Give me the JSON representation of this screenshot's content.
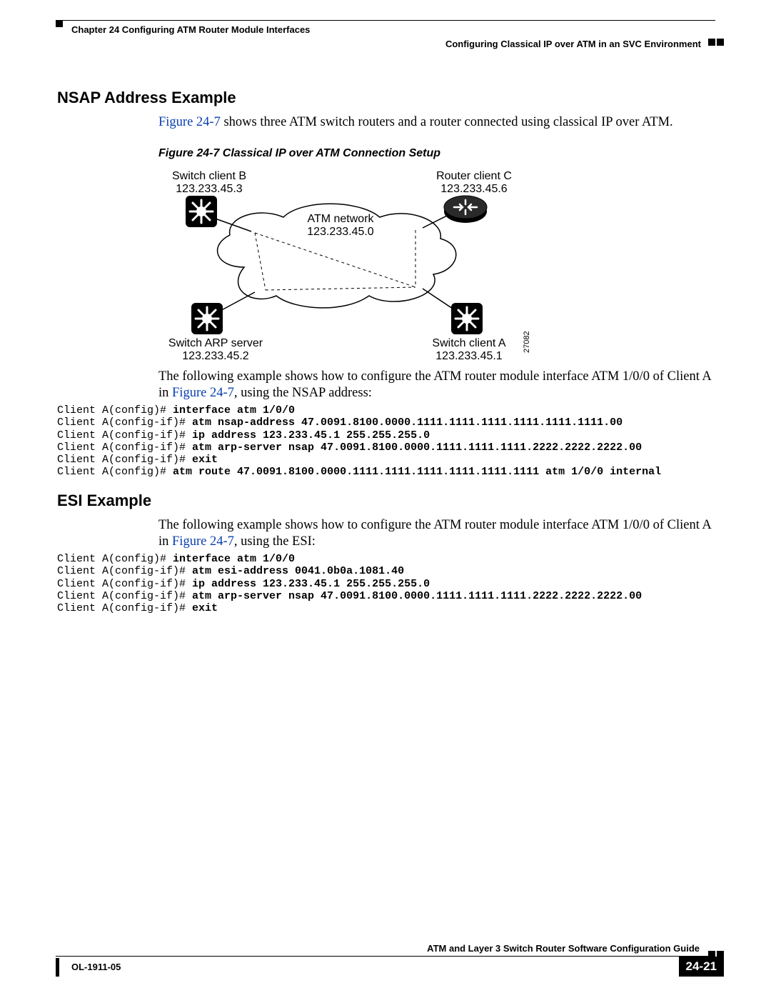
{
  "header": {
    "chapter": "Chapter 24    Configuring ATM Router Module Interfaces",
    "section": "Configuring Classical IP over ATM in an SVC Environment"
  },
  "h1_nsap": "NSAP Address Example",
  "p1_a": "Figure 24-7",
  "p1_b": " shows three ATM switch routers and a router connected using classical IP over ATM.",
  "fig_caption": "Figure 24-7   Classical IP over ATM Connection Setup",
  "diagram": {
    "switch_b_name": "Switch client B",
    "switch_b_ip": "123.233.45.3",
    "router_c_name": "Router client C",
    "router_c_ip": "123.233.45.6",
    "net_name": "ATM network",
    "net_ip": "123.233.45.0",
    "arp_name": "Switch ARP server",
    "arp_ip": "123.233.45.2",
    "switch_a_name": "Switch client A",
    "switch_a_ip": "123.233.45.1",
    "fig_id": "27082"
  },
  "p2_a": "The following example shows how to configure the ATM router module interface ATM 1/0/0 of Client A in ",
  "p2_link": "Figure 24-7",
  "p2_b": ", using the NSAP address:",
  "cli1": {
    "l1p": "Client A(config)# ",
    "l1b": "interface atm 1/0/0",
    "l2p": "Client A(config-if)# ",
    "l2b": "atm nsap-address 47.0091.8100.0000.1111.1111.1111.1111.1111.1111.00",
    "l3p": "Client A(config-if)# ",
    "l3b": "ip address 123.233.45.1 255.255.255.0",
    "l4p": "Client A(config-if)# ",
    "l4b": "atm arp-server nsap 47.0091.8100.0000.1111.1111.1111.2222.2222.2222.00",
    "l5p": "Client A(config-if)# ",
    "l5b": "exit",
    "l6p": "Client A(config)# ",
    "l6b": "atm route 47.0091.8100.0000.1111.1111.1111.1111.1111.1111 atm 1/0/0 internal"
  },
  "h1_esi": "ESI Example",
  "p3_a": "The following example shows how to configure the ATM router module interface ATM 1/0/0 of Client A in ",
  "p3_link": "Figure 24-7",
  "p3_b": ", using the ESI:",
  "cli2": {
    "l1p": "Client A(config)# ",
    "l1b": "interface atm 1/0/0",
    "l2p": "Client A(config-if)# ",
    "l2b": "atm esi-address 0041.0b0a.1081.40",
    "l3p": "Client A(config-if)# ",
    "l3b": "ip address 123.233.45.1 255.255.255.0",
    "l4p": "Client A(config-if)# ",
    "l4b": "atm arp-server nsap 47.0091.8100.0000.1111.1111.1111.2222.2222.2222.00",
    "l5p": "Client A(config-if)# ",
    "l5b": "exit"
  },
  "footer": {
    "guide": "ATM and Layer 3 Switch Router Software Configuration Guide",
    "ol": "OL-1911-05",
    "pageno": "24-21"
  }
}
